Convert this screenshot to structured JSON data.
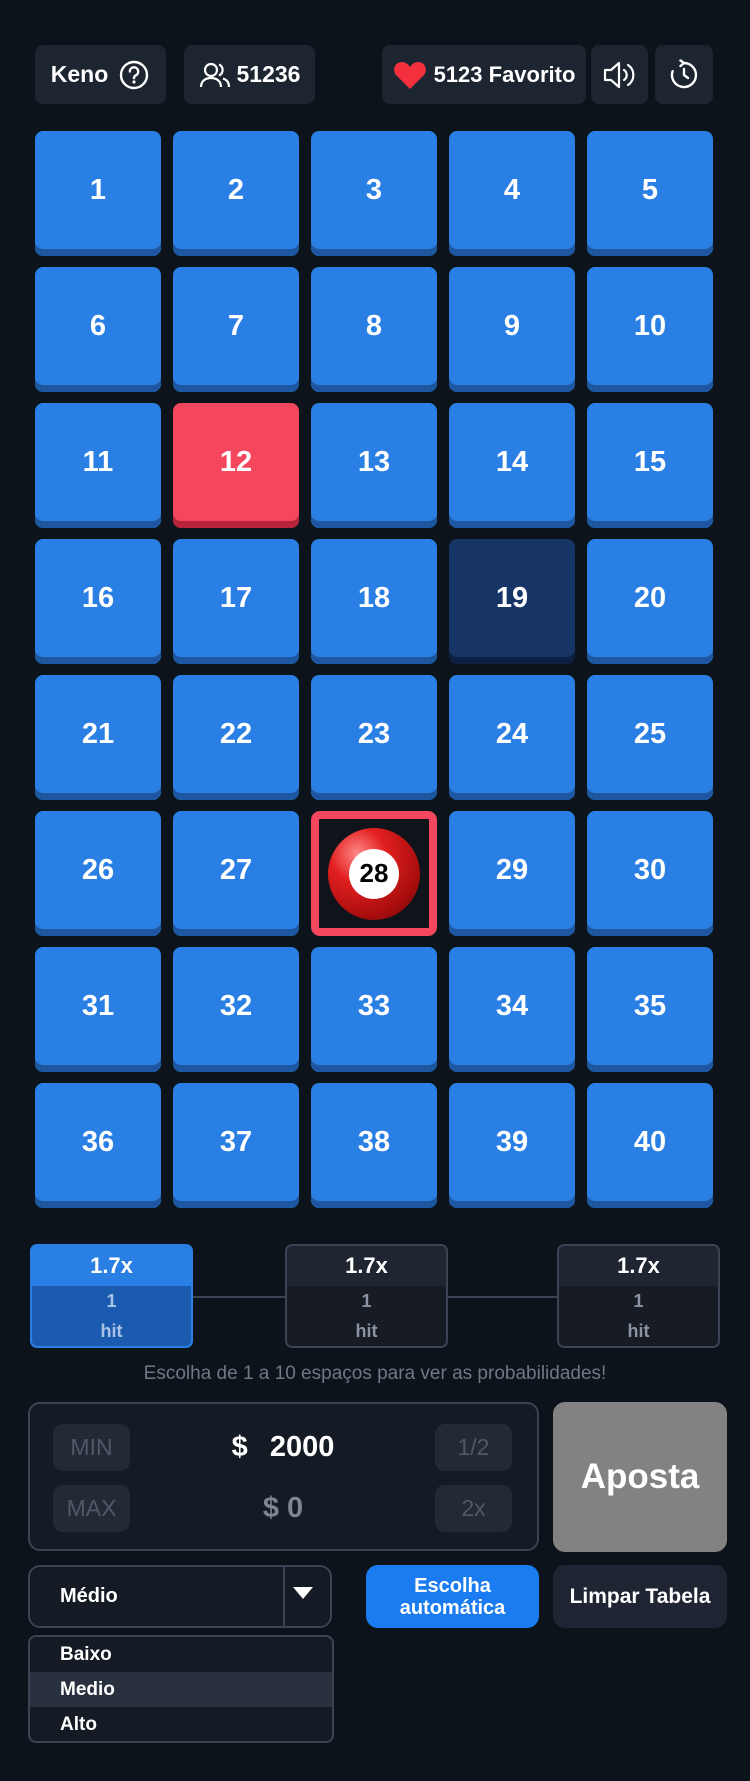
{
  "topbar": {
    "game_label": "Keno",
    "players_count": "51236",
    "favorites_label": "5123 Favorito"
  },
  "grid": {
    "numbers": [
      "1",
      "2",
      "3",
      "4",
      "5",
      "6",
      "7",
      "8",
      "9",
      "10",
      "11",
      "12",
      "13",
      "14",
      "15",
      "16",
      "17",
      "18",
      "19",
      "20",
      "21",
      "22",
      "23",
      "24",
      "25",
      "26",
      "27",
      "28",
      "29",
      "30",
      "31",
      "32",
      "33",
      "34",
      "35",
      "36",
      "37",
      "38",
      "39",
      "40"
    ],
    "selected": [
      "12"
    ],
    "highlighted": [
      "19"
    ],
    "drawn": [
      "28"
    ]
  },
  "payouts": [
    {
      "multiplier": "1.7x",
      "count": "1",
      "label": "hit"
    },
    {
      "multiplier": "1.7x",
      "count": "1",
      "label": "hit"
    },
    {
      "multiplier": "1.7x",
      "count": "1",
      "label": "hit"
    }
  ],
  "hint": "Escolha de 1 a 10 espaços para ver as probabilidades!",
  "bet": {
    "min_label": "MIN",
    "max_label": "MAX",
    "half_label": "1/2",
    "double_label": "2x",
    "currency": "$",
    "amount": "2000",
    "profit": "$ 0",
    "place_bet_label": "Aposta"
  },
  "risk": {
    "selected": "Médio",
    "options": [
      "Baixo",
      "Medio",
      "Alto"
    ]
  },
  "auto_pick_label": "Escolha automática",
  "clear_label": "Limpar Tabela",
  "colors": {
    "background": "#0d131b",
    "tile": "#2a7fe4",
    "tile_selected": "#f4465d",
    "tile_dark": "#173466",
    "accent_blue": "#1a7cf0"
  }
}
